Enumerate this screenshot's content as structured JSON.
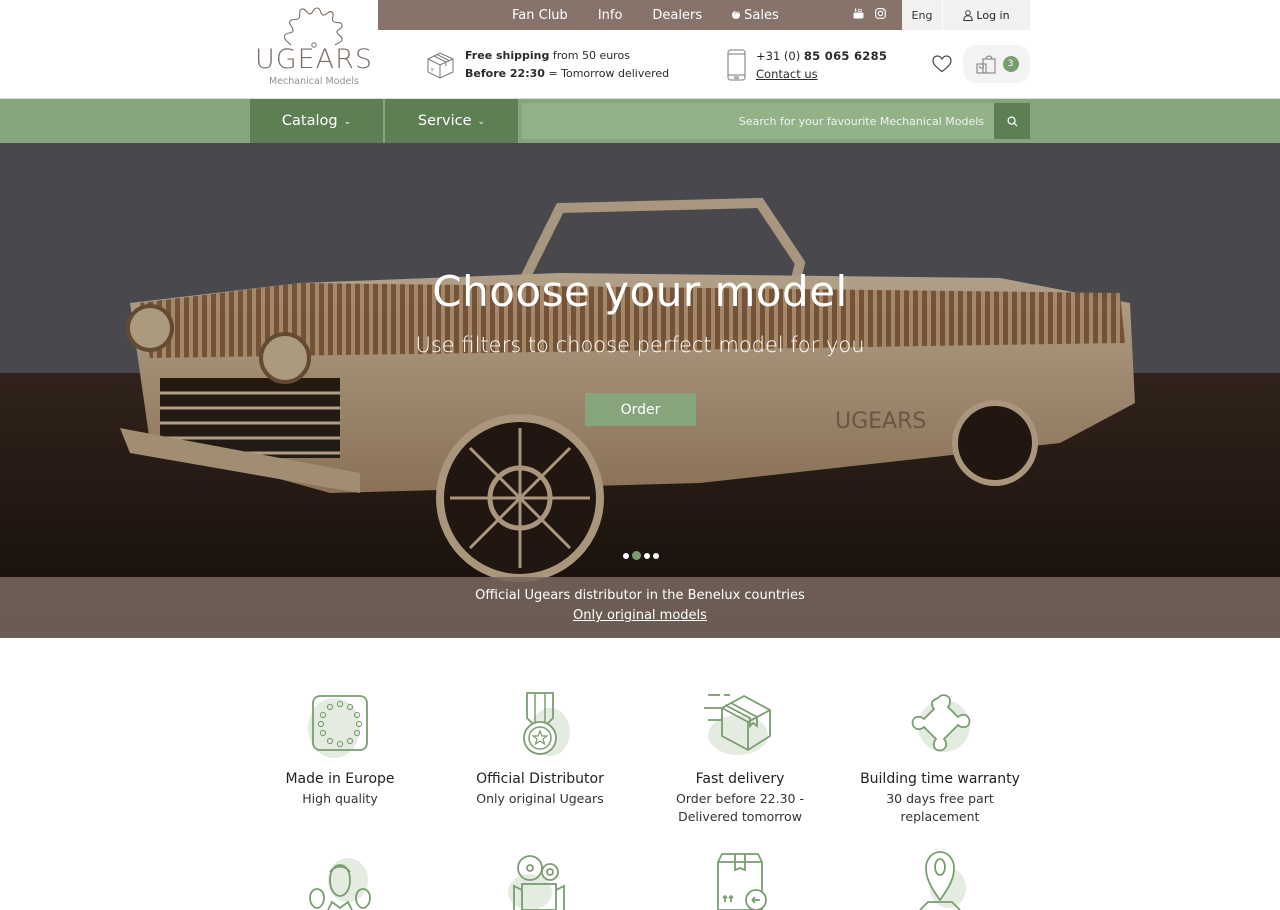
{
  "brand": {
    "name": "UGEARS",
    "tagline": "Mechanical Models"
  },
  "topbar": {
    "links": [
      {
        "label": "Fan Club"
      },
      {
        "label": "Info"
      },
      {
        "label": "Dealers"
      },
      {
        "label": "Sales",
        "icon": "sale-badge-icon"
      }
    ],
    "social": [
      "youtube-icon",
      "instagram-icon"
    ],
    "language": "Eng",
    "login_label": "Log in"
  },
  "shipping": {
    "line1_bold": "Free shipping",
    "line1_rest": " from 50 euros",
    "line2_bold": "Before 22:30",
    "line2_rest": " = Tomorrow delivered"
  },
  "contact": {
    "phone_prefix": "+31 (0) ",
    "phone_number": "85 065 6285",
    "link_label": "Contact us"
  },
  "cart": {
    "count": "3"
  },
  "nav": {
    "catalog_label": "Catalog",
    "service_label": "Service",
    "search_placeholder": "Search for your favourite Mechanical Models"
  },
  "hero": {
    "title": "Choose your model",
    "subtitle": "Use filters to choose perfect model for you",
    "button_label": "Order",
    "slides_total": 4,
    "active_slide": 2,
    "strip_line1": "Official Ugears distributor in the Benelux countries",
    "strip_line2": "Only original models"
  },
  "features": [
    {
      "icon": "eu-stars-icon",
      "title": "Made in Europe",
      "desc": "High quality"
    },
    {
      "icon": "medal-icon",
      "title": "Official Distributor",
      "desc": "Only original Ugears"
    },
    {
      "icon": "fast-delivery-box-icon",
      "title": "Fast delivery",
      "desc": "Order before 22.30 - Delivered tomorrow"
    },
    {
      "icon": "puzzle-piece-icon",
      "title": "Building time warranty",
      "desc": "30 days free part replacement"
    }
  ],
  "features_row2_icons": [
    "people-group-icon",
    "film-camera-icon",
    "return-box-icon",
    "map-pin-icon"
  ],
  "colors": {
    "brown": "#87736a",
    "green_dark": "#5e7f53",
    "green": "#86a57c",
    "green_light": "#94b28a",
    "icon_green": "#7a9d72"
  }
}
